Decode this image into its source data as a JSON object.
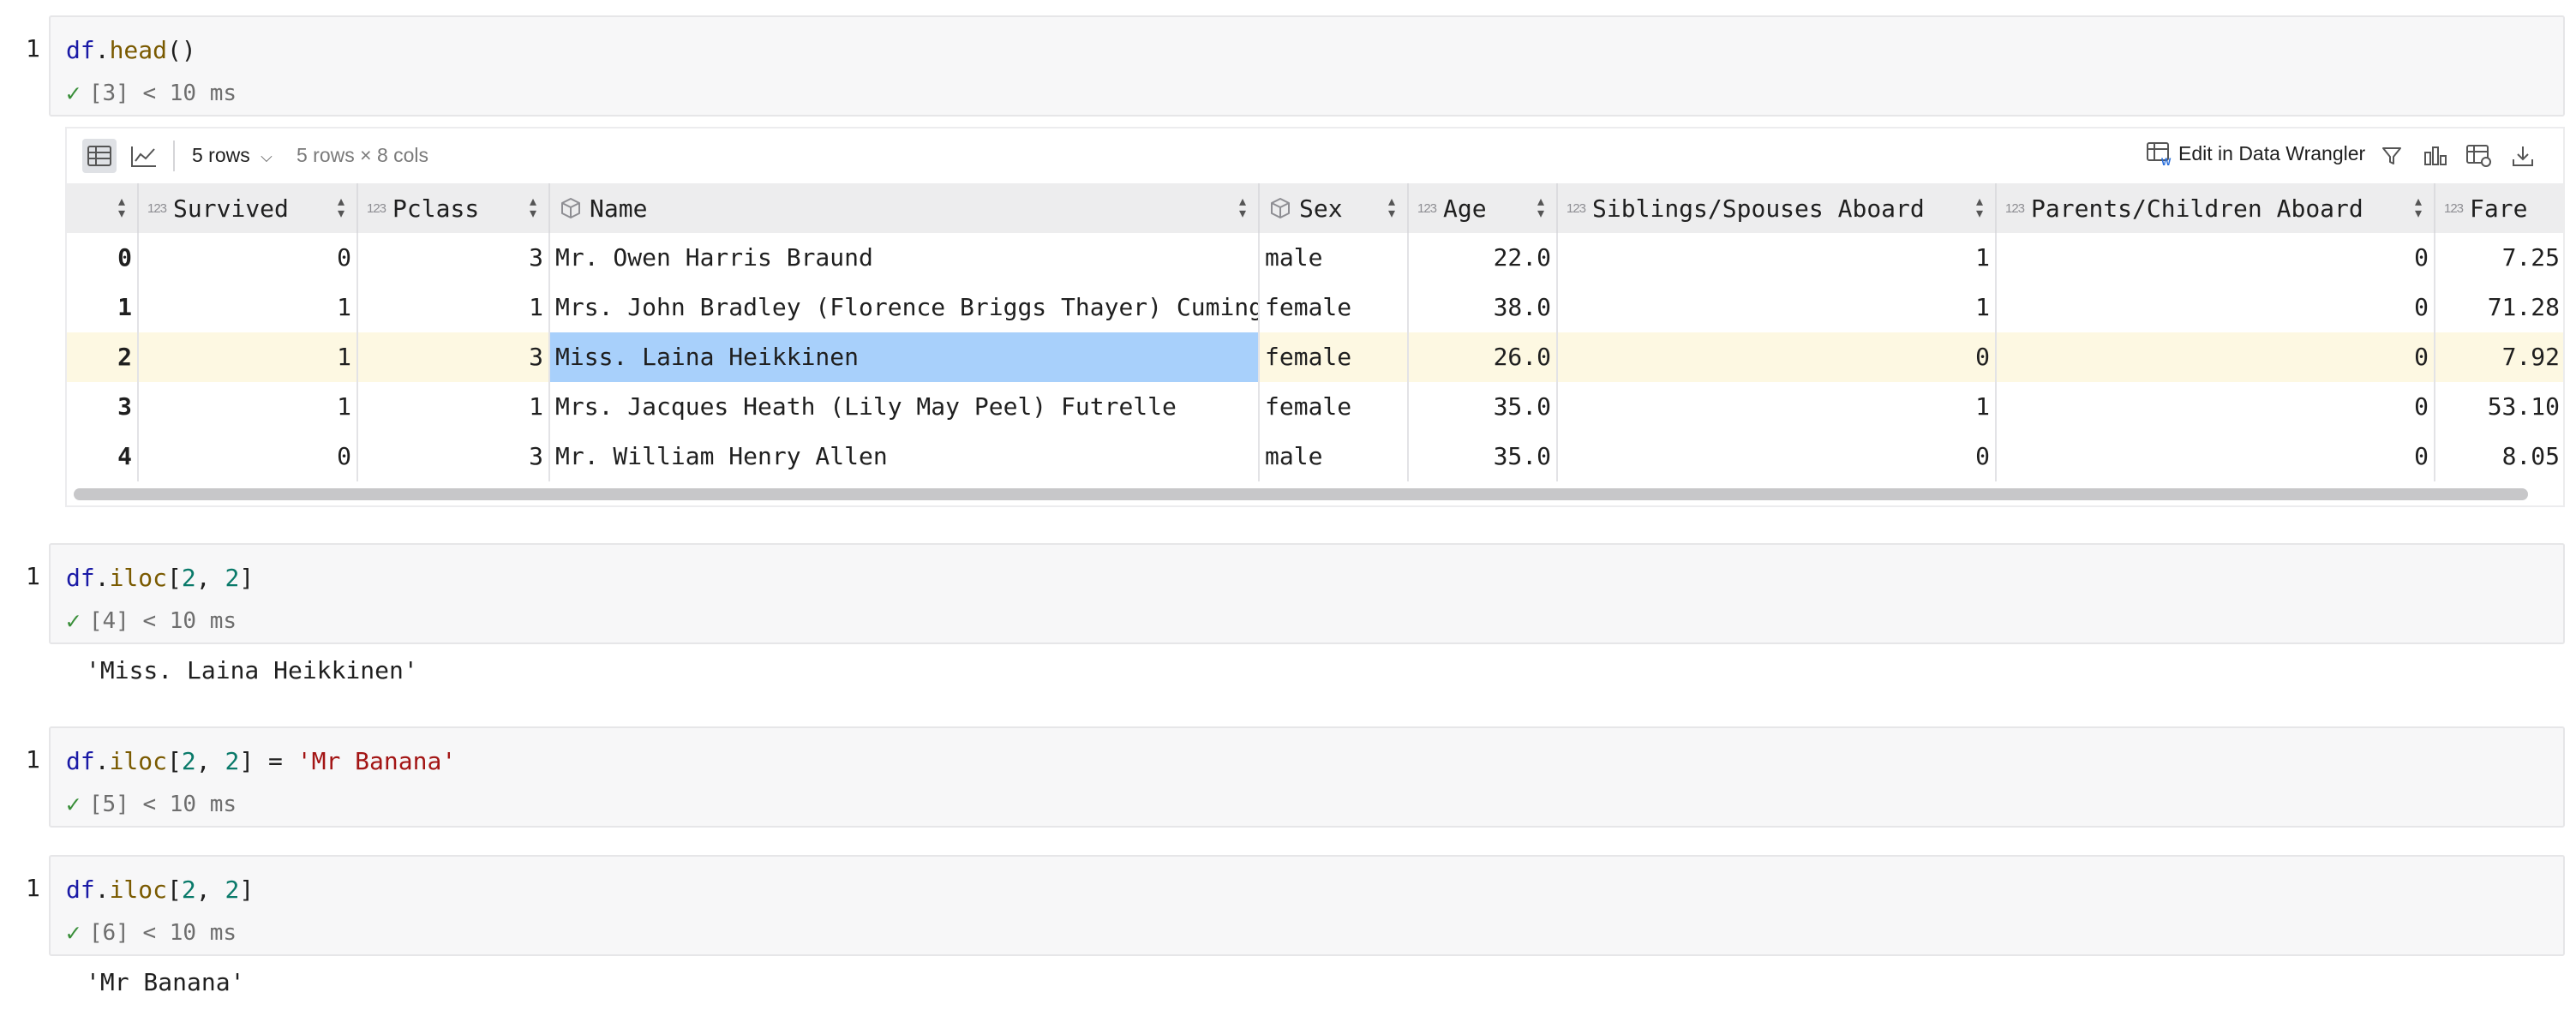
{
  "cells": [
    {
      "number": "1",
      "status": "[3] < 10 ms"
    },
    {
      "number": "1",
      "status": "[4] < 10 ms",
      "output": "'Miss. Laina Heikkinen'"
    },
    {
      "number": "1",
      "status": "[5] < 10 ms"
    },
    {
      "number": "1",
      "status": "[6] < 10 ms",
      "output": "'Mr Banana'"
    }
  ],
  "code": {
    "c1": {
      "var": "df",
      "dot": ".",
      "fn": "head",
      "rest": "()"
    },
    "c2": {
      "var": "df",
      "dot": ".",
      "fn": "iloc",
      "open": "[",
      "n1": "2",
      "comma": ", ",
      "n2": "2",
      "close": "]"
    },
    "c3": {
      "var": "df",
      "dot": ".",
      "fn": "iloc",
      "open": "[",
      "n1": "2",
      "comma": ", ",
      "n2": "2",
      "close": "]",
      "assign": " = ",
      "str": "'Mr Banana'"
    },
    "c4": {
      "var": "df",
      "dot": ".",
      "fn": "iloc",
      "open": "[",
      "n1": "2",
      "comma": ", ",
      "n2": "2",
      "close": "]"
    }
  },
  "viewer": {
    "rows_dropdown": "5 rows",
    "shape": "5 rows × 8 cols",
    "edit_label": "Edit in Data Wrangler",
    "type_icon_num": "123",
    "columns": [
      "",
      "Survived",
      "Pclass",
      "Name",
      "Sex",
      "Age",
      "Siblings/Spouses Aboard",
      "Parents/Children Aboard",
      "Fare"
    ],
    "rows": [
      [
        "0",
        "0",
        "3",
        "Mr. Owen Harris Braund",
        "male",
        "22.0",
        "1",
        "0",
        "7.25"
      ],
      [
        "1",
        "1",
        "1",
        "Mrs. John Bradley (Florence Briggs Thayer) Cumings",
        "female",
        "38.0",
        "1",
        "0",
        "71.28"
      ],
      [
        "2",
        "1",
        "3",
        "Miss. Laina Heikkinen",
        "female",
        "26.0",
        "0",
        "0",
        "7.92"
      ],
      [
        "3",
        "1",
        "1",
        "Mrs. Jacques Heath (Lily May Peel) Futrelle",
        "female",
        "35.0",
        "1",
        "0",
        "53.10"
      ],
      [
        "4",
        "0",
        "3",
        "Mr. William Henry Allen",
        "male",
        "35.0",
        "0",
        "0",
        "8.05"
      ]
    ],
    "highlight_row": 2,
    "selected_cell": {
      "row": 2,
      "col": 3
    },
    "colors": {
      "highlight": "#fdf8e2",
      "selection": "#a8d0fb"
    }
  }
}
